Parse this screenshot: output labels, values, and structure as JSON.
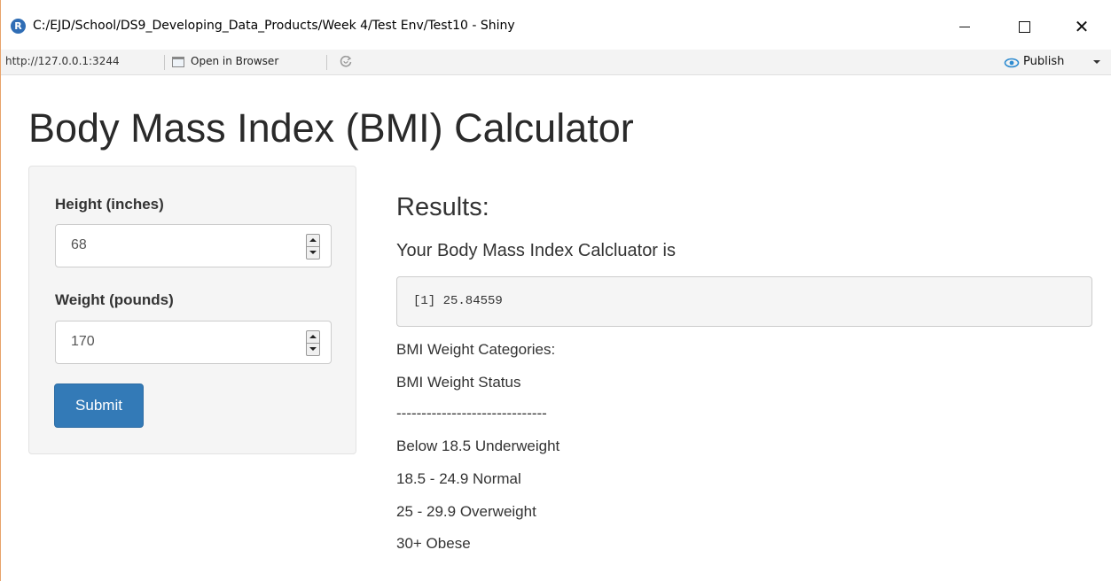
{
  "window": {
    "title": "C:/EJD/School/DS9_Developing_Data_Products/Week 4/Test Env/Test10 - Shiny",
    "app_icon": "r-logo-icon",
    "minimize_symbol": "—",
    "maximize_symbol": "☐",
    "close_symbol": "✕"
  },
  "toolbar": {
    "url": "http://127.0.0.1:3244",
    "open_in_browser_label": "Open in Browser",
    "publish_label": "Publish"
  },
  "page": {
    "title": "Body Mass Index (BMI) Calculator"
  },
  "sidebar": {
    "height_label": "Height (inches)",
    "height_value": "68",
    "weight_label": "Weight (pounds)",
    "weight_value": "170",
    "submit_label": "Submit"
  },
  "results": {
    "heading": "Results:",
    "subheading": "Your Body Mass Index Calcluator is",
    "output": "[1] 25.84559",
    "categories": [
      "BMI Weight Categories:",
      "BMI Weight Status",
      "------------------------------",
      "Below 18.5 Underweight",
      "18.5 - 24.9 Normal",
      "25 - 29.9 Overweight",
      "30+ Obese"
    ]
  },
  "colors": {
    "accent": "#337ab7",
    "window_border": "#e8a36a",
    "publish_icon": "#2e8bd0"
  }
}
